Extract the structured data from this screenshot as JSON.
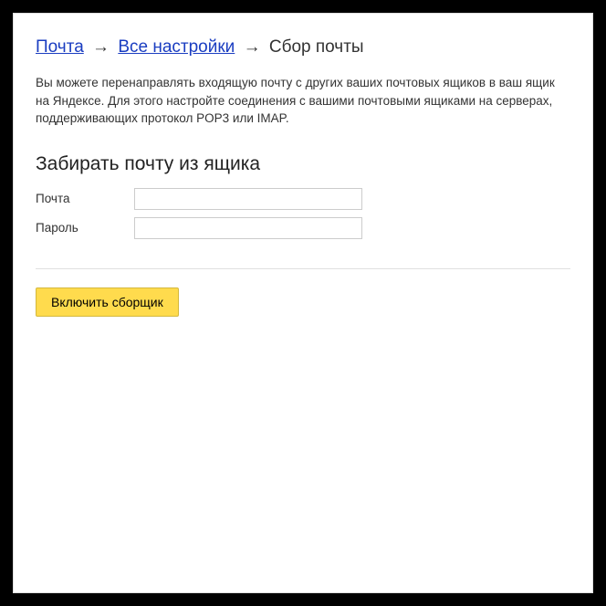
{
  "breadcrumb": {
    "mail": "Почта",
    "all_settings": "Все настройки",
    "current": "Сбор почты",
    "separator": "→"
  },
  "description": "Вы можете перенаправлять входящую почту с других ваших почтовых ящиков в ваш ящик на Яндексе. Для этого настройте соединения с вашими почтовыми ящиками на серверах, поддерживающих протокол POP3 или IMAP.",
  "section_title": "Забирать почту из ящика",
  "form": {
    "email_label": "Почта",
    "password_label": "Пароль",
    "email_value": "",
    "password_value": ""
  },
  "submit_label": "Включить сборщик"
}
